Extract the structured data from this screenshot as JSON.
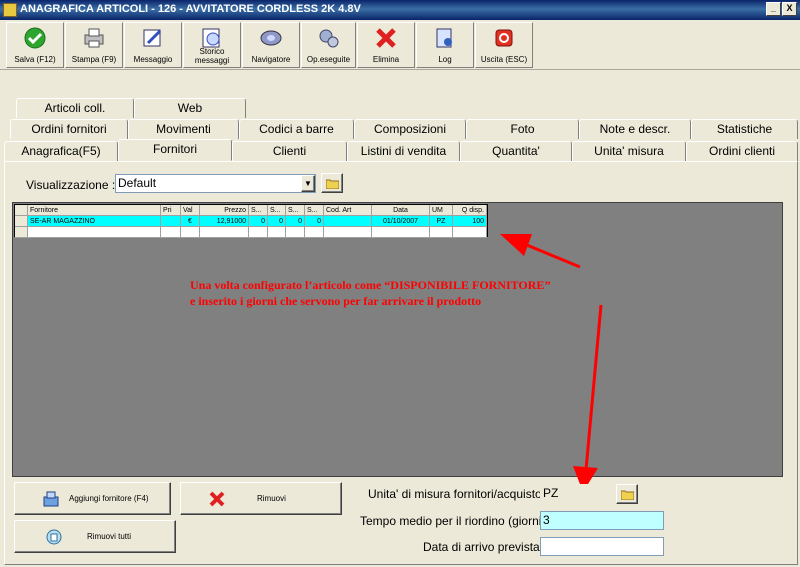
{
  "window": {
    "title": "ANAGRAFICA ARTICOLI - 126 - AVVITATORE CORDLESS 2K 4.8V",
    "minimize_glyph": "_",
    "close_glyph": "X"
  },
  "toolbar": {
    "buttons": [
      {
        "label": "Salva (F12)",
        "icon": "check-icon"
      },
      {
        "label": "Stampa (F9)",
        "icon": "printer-icon"
      },
      {
        "label": "Messaggio",
        "icon": "message-icon"
      },
      {
        "label": "Storico messaggi",
        "icon": "message-history-icon"
      },
      {
        "label": "Navigatore",
        "icon": "navigator-icon"
      },
      {
        "label": "Op.eseguite",
        "icon": "operations-icon"
      },
      {
        "label": "Elimina",
        "icon": "delete-icon"
      },
      {
        "label": "Log",
        "icon": "log-icon"
      },
      {
        "label": "Uscita (ESC)",
        "icon": "exit-icon"
      }
    ]
  },
  "tabs": {
    "row1": [
      "Articoli coll.",
      "Web"
    ],
    "row2": [
      "Ordini fornitori",
      "Movimenti",
      "Codici a barre",
      "Composizioni",
      "Foto",
      "Note e descr.",
      "Statistiche"
    ],
    "row3": [
      "Anagrafica(F5)",
      "Fornitori",
      "Clienti",
      "Listini di vendita",
      "Quantita'",
      "Unita' misura",
      "Ordini clienti"
    ],
    "active": "Fornitori"
  },
  "view": {
    "label": "Visualizzazione :",
    "value": "Default"
  },
  "grid": {
    "columns": [
      "Fornitore",
      "Pri",
      "Val",
      "Prezzo",
      "S...",
      "S...",
      "S...",
      "S...",
      "Cod. Art",
      "Data",
      "UM",
      "Q disp."
    ],
    "rows": [
      [
        "SE-AR MAGAZZINO",
        "",
        "€",
        "12,91000",
        "0",
        "0",
        "0",
        "0",
        "",
        "01/10/2007",
        "PZ",
        "100"
      ]
    ]
  },
  "annotation": {
    "line1": "Una volta configurato l’articolo come “DISPONIBILE FORNITORE”",
    "line2": "e inserito i giorni che servono per far arrivare il prodotto",
    "color": "#ff0000"
  },
  "buttons": {
    "add_supplier": "Aggiungi fornitore (F4)",
    "remove": "Rimuovi",
    "remove_all": "Rimuovi tutti"
  },
  "fields": {
    "unit_label": "Unita' di misura fornitori/acquisto :",
    "unit_value": "PZ",
    "reorder_label": "Tempo medio per il riordino (giorni) :",
    "reorder_value": "3",
    "arrival_label": "Data di arrivo prevista :",
    "arrival_value": ""
  }
}
